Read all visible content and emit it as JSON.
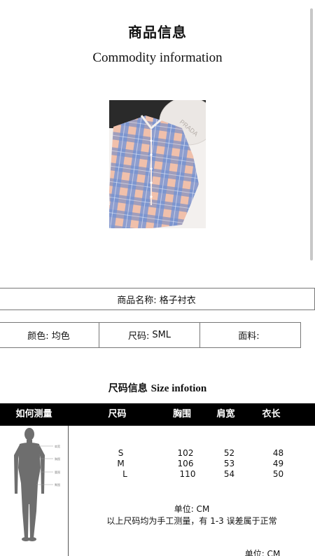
{
  "header": {
    "title_cn": "商品信息",
    "title_en": "Commodity information"
  },
  "product": {
    "name_label": "商品名称:",
    "name_value": "格子衬衣",
    "photo_icon": "plaid-shirt-photo"
  },
  "attributes": [
    {
      "label": "颜色:",
      "value": "均色"
    },
    {
      "label": "尺码:",
      "value": "SML"
    },
    {
      "label": "面料:",
      "value": ""
    }
  ],
  "size_info": {
    "title_cn": "尺码信息",
    "title_en": "Size infotion",
    "headers": [
      "如何测量",
      "尺码",
      "胸围",
      "肩宽",
      "衣长"
    ],
    "rows": [
      {
        "size": "S",
        "chest": "102",
        "shoulder": "52",
        "length": "48"
      },
      {
        "size": "M",
        "chest": "106",
        "shoulder": "53",
        "length": "49"
      },
      {
        "size": "L",
        "chest": "110",
        "shoulder": "54",
        "length": "50"
      }
    ],
    "unit": "单位: CM",
    "note": "以上尺码均为手工测量，有 1-3 误差属于正常",
    "unit_bottom": "单位: CM",
    "figure_icon": "body-measurement-figure-icon"
  },
  "colors": {
    "header_bg": "#000000",
    "border": "#777777",
    "plaid_blue": "#6f8fd0",
    "plaid_pink": "#e9a98f"
  }
}
